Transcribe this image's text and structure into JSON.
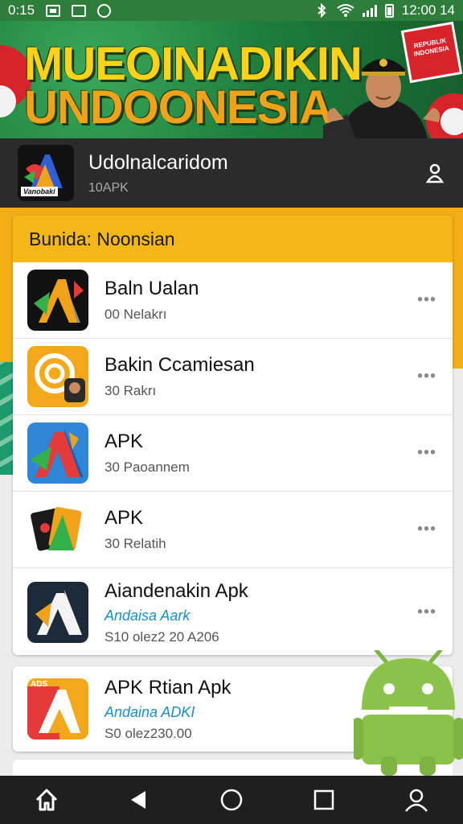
{
  "status_bar": {
    "time": "0:15",
    "clock": "12:00 14"
  },
  "banner": {
    "line1": "MUEOINADIKIN",
    "line2": "UNDOONESIA",
    "flag_text": "REPUBLIK INDONESIA"
  },
  "app_header": {
    "name": "Udolnalcaridom",
    "subtitle": "10APK",
    "logo_tag": "Vanobaki"
  },
  "card": {
    "header": "Bunida: Noonsian",
    "items": [
      {
        "title": "Baln Ualan",
        "subtitle": "00 Nelakrı",
        "icon": "a-logo-icon"
      },
      {
        "title": "Bakin Ccamiesan",
        "subtitle": "30 Rakrı",
        "icon": "orange-disc-icon"
      },
      {
        "title": "APK",
        "subtitle": "30 Paoannem",
        "icon": "a-logo-icon"
      },
      {
        "title": "APK",
        "subtitle": "30 Relatih",
        "icon": "card-logo-icon"
      },
      {
        "title": "Aiandenakin Apk",
        "link": "Andaisa Aark",
        "date": "S10 olez2 20 A206",
        "icon": "a-logo-icon"
      }
    ]
  },
  "card2": {
    "title": "APK Rtian Apk",
    "link": "Andaina ADKI",
    "date": "S0 olez230.00",
    "badge": "ADS"
  },
  "more_label": "•••",
  "colors": {
    "accent": "#f5b617",
    "header_bg": "#2b2b2b",
    "link": "#1b8ec9",
    "banner_green": "#1e7d3c"
  }
}
